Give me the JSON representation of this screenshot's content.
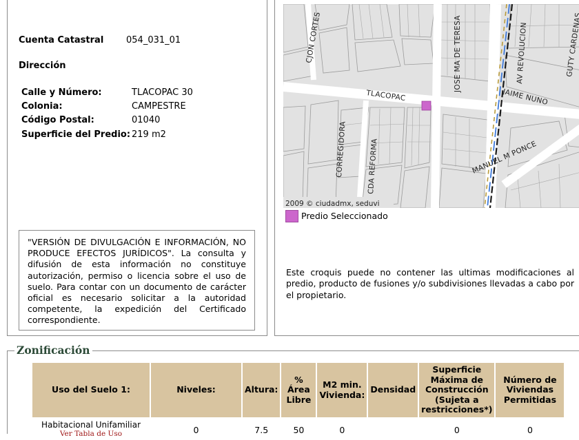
{
  "predio": {
    "cuenta_label": "Cuenta Catastral",
    "cuenta_value": "054_031_01",
    "direccion_label": "Dirección",
    "calle_label": "Calle y Número:",
    "calle_value": "TLACOPAC 30",
    "colonia_label": "Colonia:",
    "colonia_value": "CAMPESTRE",
    "cp_label": "Código Postal:",
    "cp_value": "01040",
    "superficie_label": "Superficie del Predio:",
    "superficie_value": "219 m2"
  },
  "disclaimer": "\"VERSIÓN DE DIVULGACIÓN E INFORMACIÓN, NO PRODUCE EFECTOS JURÍDICOS\". La consulta y difusión de esta información no constituye autorización, permiso o licencia sobre el uso de suelo. Para contar con un documento de carácter oficial es necesario solicitar a la autoridad competente, la expedición del Certificado correspondiente.",
  "map": {
    "streets": [
      "CJON CORTES",
      "JOSE MA DE TERESA",
      "AV REVOLUCION",
      "GUTY CARDENAS",
      "TLACOPAC",
      "JAIME NUNO",
      "CORREGIDORA",
      "CDA REFORMA",
      "MANUEL M PONCE"
    ],
    "credit": "2009 © ciudadmx, seduvi",
    "selected_color": "#cc66cc",
    "legend_label": "Predio Seleccionado"
  },
  "note": "Este croquis puede no contener las ultimas modificaciones al predio, producto de fusiones y/o subdivisiones llevadas a cabo por el propietario.",
  "zonificacion": {
    "title": "Zonificación",
    "headers": [
      "Uso del Suelo 1:",
      "Niveles:",
      "Altura:",
      "% Área Libre",
      "M2 min. Vivienda:",
      "Densidad",
      "Superficie Máxima de Construcción (Sujeta a restricciones*)",
      "Número de Viviendas Permitidas"
    ],
    "row": {
      "uso": "Habitacional Unifamiliar",
      "uso_link": "Ver Tabla de Uso",
      "niveles": "0",
      "altura": "7.5",
      "area_libre": "50",
      "m2_min": "0",
      "densidad": "",
      "superficie_max": "0",
      "viviendas": "0"
    }
  }
}
